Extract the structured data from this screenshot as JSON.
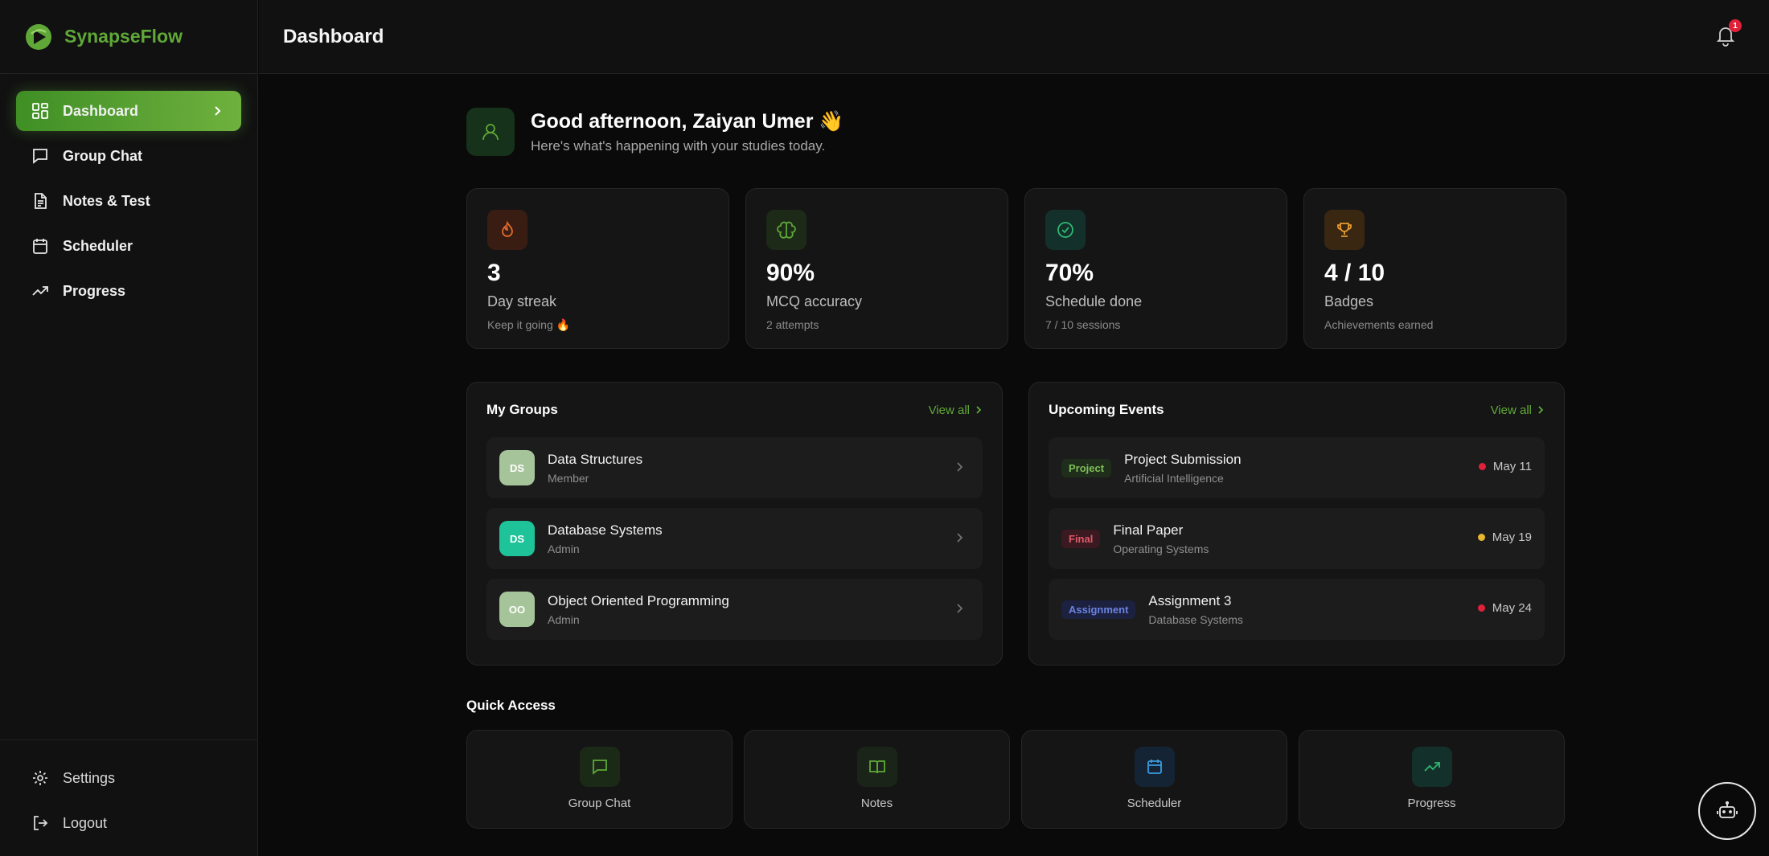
{
  "app": {
    "name": "SynapseFlow",
    "brand_color": "#5fa838"
  },
  "sidebar": {
    "items": [
      {
        "label": "Dashboard",
        "icon": "grid-icon",
        "active": true
      },
      {
        "label": "Group Chat",
        "icon": "chat-icon"
      },
      {
        "label": "Notes & Test",
        "icon": "document-icon"
      },
      {
        "label": "Scheduler",
        "icon": "calendar-icon"
      },
      {
        "label": "Progress",
        "icon": "trend-icon"
      }
    ],
    "bottom": [
      {
        "label": "Settings",
        "icon": "gear-icon"
      },
      {
        "label": "Logout",
        "icon": "logout-icon"
      }
    ]
  },
  "header": {
    "title": "Dashboard",
    "notification_count": "1"
  },
  "greeting": {
    "title": "Good afternoon, Zaiyan Umer 👋",
    "subtitle": "Here's what's happening with your studies today."
  },
  "stats": [
    {
      "value": "3",
      "label": "Day streak",
      "note": "Keep it going 🔥",
      "icon": "flame-icon",
      "color": "#e06a2c"
    },
    {
      "value": "90%",
      "label": "MCQ accuracy",
      "note": "2 attempts",
      "icon": "brain-icon",
      "color": "#5fa838"
    },
    {
      "value": "70%",
      "label": "Schedule done",
      "note": "7 / 10 sessions",
      "icon": "check-circle-icon",
      "color": "#2fb872"
    },
    {
      "value": "4 / 10",
      "label": "Badges",
      "note": "Achievements earned",
      "icon": "trophy-icon",
      "color": "#e89b2e"
    }
  ],
  "groups": {
    "title": "My Groups",
    "view_all": "View all",
    "items": [
      {
        "initials": "DS",
        "name": "Data Structures",
        "role": "Member",
        "color": "#a6c49a"
      },
      {
        "initials": "DS",
        "name": "Database Systems",
        "role": "Admin",
        "color": "#1fc39a"
      },
      {
        "initials": "OO",
        "name": "Object Oriented Programming",
        "role": "Admin",
        "color": "#a6c49a"
      }
    ]
  },
  "events": {
    "title": "Upcoming Events",
    "view_all": "View all",
    "items": [
      {
        "tag": "Project",
        "title": "Project Submission",
        "subject": "Artificial Intelligence",
        "date": "May 11",
        "tag_color": "#7fbf5a",
        "tag_bg": "#1f2e1b",
        "dot": "#e0213a"
      },
      {
        "tag": "Final",
        "title": "Final Paper",
        "subject": "Operating Systems",
        "date": "May 19",
        "tag_color": "#e0586a",
        "tag_bg": "#3a1a20",
        "dot": "#e8b52e"
      },
      {
        "tag": "Assignment",
        "title": "Assignment 3",
        "subject": "Database Systems",
        "date": "May 24",
        "tag_color": "#6b83e0",
        "tag_bg": "#1c2140",
        "dot": "#e0213a"
      }
    ]
  },
  "quick_access": {
    "title": "Quick Access",
    "items": [
      {
        "label": "Group Chat",
        "icon": "chat-icon",
        "color": "#5fa838",
        "bg": "#1a2a17"
      },
      {
        "label": "Notes",
        "icon": "book-icon",
        "color": "#5fa838",
        "bg": "#1a2418"
      },
      {
        "label": "Scheduler",
        "icon": "calendar-icon",
        "color": "#3a9be0",
        "bg": "#142434"
      },
      {
        "label": "Progress",
        "icon": "trend-icon",
        "color": "#2fb872",
        "bg": "#14302a"
      }
    ]
  }
}
